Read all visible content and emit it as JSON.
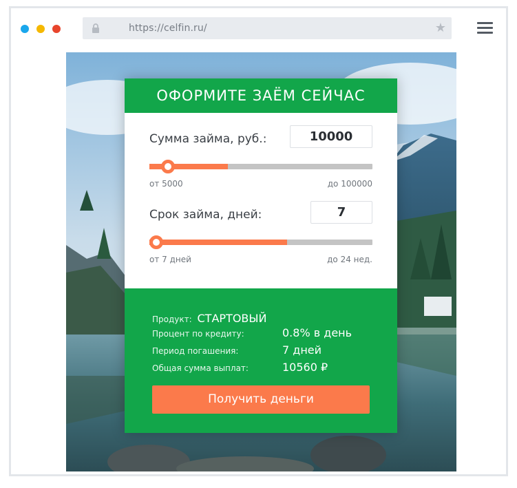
{
  "browser": {
    "url": "https://celfin.ru/",
    "colors": {
      "dot_blue": "#1aa7ec",
      "dot_yellow": "#f5b800",
      "dot_red": "#e8452c"
    },
    "icons": {
      "lock": "lock-icon",
      "star": "star-icon",
      "menu": "hamburger-menu-icon"
    }
  },
  "form": {
    "title": "ОФОРМИТЕ ЗАЁМ СЕЙЧАС",
    "amount": {
      "label": "Сумма займа, руб.:",
      "value": "10000",
      "min_label": "от 5000",
      "max_label": "до 100000",
      "slider_value": 10000,
      "slider_min": 5000,
      "slider_max": 100000
    },
    "term": {
      "label": "Срок займа, дней:",
      "value": "7",
      "min_label": "от 7 дней",
      "max_label": "до 24 нед.",
      "slider_value": 7,
      "slider_min": 7,
      "slider_max": 168
    }
  },
  "summary": {
    "product_label": "Продукт:",
    "product_value": "СТАРТОВЫЙ",
    "rate_label": "Процент по кредиту:",
    "rate_value": "0.8% в день",
    "period_label": "Период погашения:",
    "period_value": "7 дней",
    "total_label": "Общая сумма выплат:",
    "total_value": "10560 ₽",
    "button_label": "Получить деньги"
  },
  "colors": {
    "brand_green": "#12a64a",
    "accent_orange": "#fb7a4b",
    "track_gray": "#c4c4c4"
  }
}
